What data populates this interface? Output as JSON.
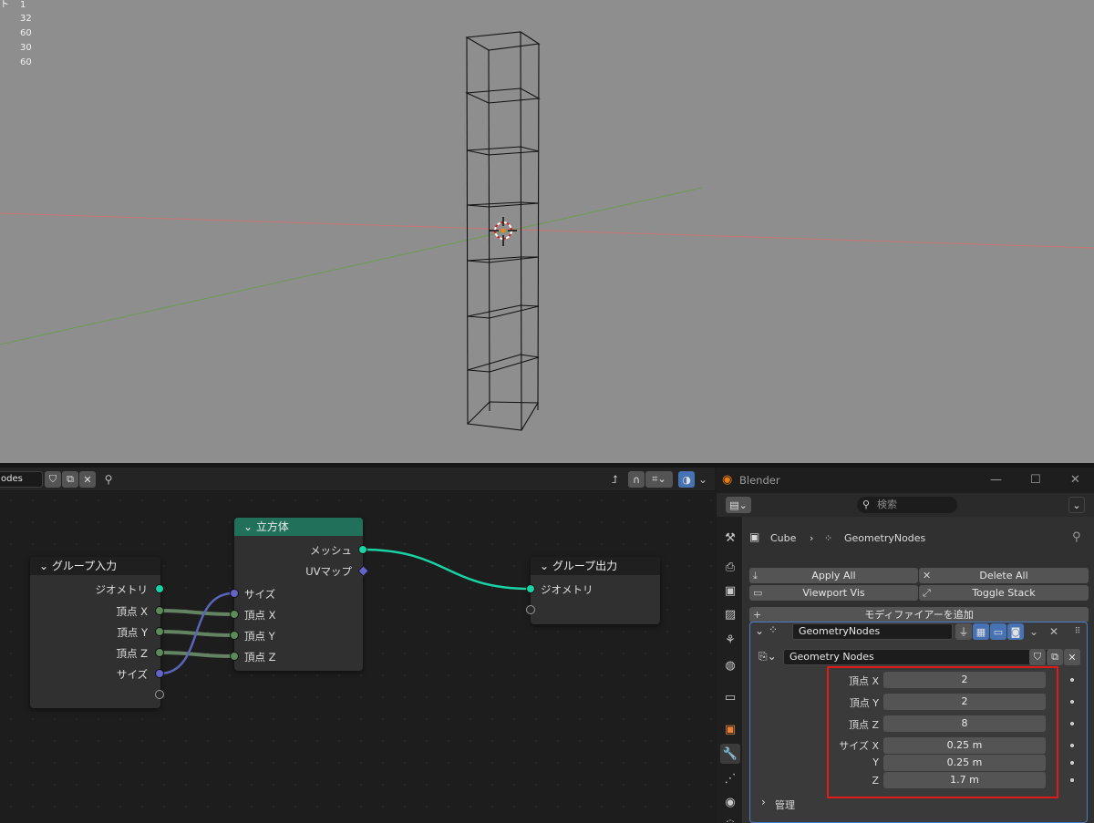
{
  "viewport": {
    "stats": [
      "1",
      "32",
      "60",
      "30",
      "60"
    ],
    "colors": {
      "background": "#8e8e8e",
      "x_axis": "#c96d6d",
      "y_axis": "#6c9a51"
    }
  },
  "node_editor": {
    "tree_name": "odes",
    "nodes": {
      "group_input": {
        "title": "グループ入力",
        "outputs": [
          "ジオメトリ",
          "頂点 X",
          "頂点 Y",
          "頂点 Z",
          "サイズ"
        ]
      },
      "cube": {
        "title": "立方体",
        "outputs": [
          "メッシュ",
          "UVマップ"
        ],
        "inputs": [
          "サイズ",
          "頂点 X",
          "頂点 Y",
          "頂点 Z"
        ]
      },
      "group_output": {
        "title": "グループ出力",
        "inputs": [
          "ジオメトリ"
        ]
      }
    }
  },
  "properties": {
    "window_title": "Blender",
    "search_placeholder": "検索",
    "breadcrumb": {
      "object": "Cube",
      "modifier": "GeometryNodes"
    },
    "buttons": {
      "apply_all": "Apply All",
      "delete_all": "Delete All",
      "viewport_vis": "Viewport Vis",
      "toggle_stack": "Toggle Stack",
      "add_modifier": "モディファイアーを追加"
    },
    "modifier": {
      "name": "GeometryNodes",
      "node_group": "Geometry Nodes",
      "params": [
        {
          "label": "頂点 X",
          "value": "2"
        },
        {
          "label": "頂点 Y",
          "value": "2"
        },
        {
          "label": "頂点 Z",
          "value": "8"
        },
        {
          "label": "サイズ X",
          "value": "0.25 m"
        },
        {
          "label": "Y",
          "value": "0.25 m"
        },
        {
          "label": "Z",
          "value": "1.7 m"
        }
      ],
      "manage_label": "管理"
    },
    "accent": "#4a7bc8",
    "highlight_color": "#e01919"
  }
}
